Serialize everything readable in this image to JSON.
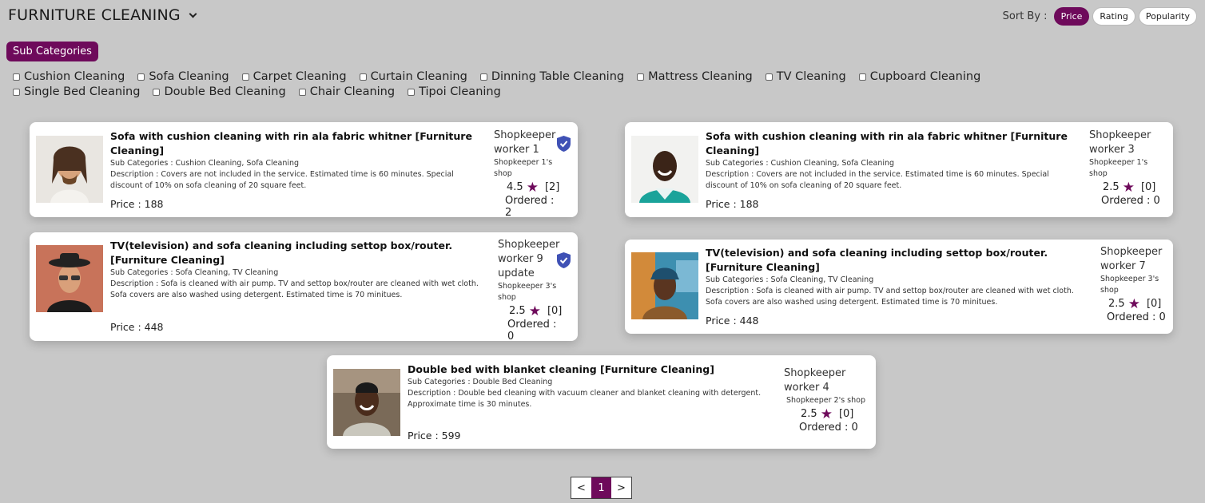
{
  "header": {
    "title": "FURNITURE CLEANING"
  },
  "sort": {
    "label": "Sort By :",
    "options": [
      "Price",
      "Rating",
      "Popularity"
    ],
    "active": "Price"
  },
  "subcategories": {
    "button_label": "Sub Categories",
    "items": [
      "Cushion Cleaning",
      "Sofa Cleaning",
      "Carpet Cleaning",
      "Curtain Cleaning",
      "Dinning Table Cleaning",
      "Mattress Cleaning",
      "TV Cleaning",
      "Cupboard Cleaning",
      "Single Bed Cleaning",
      "Double Bed Cleaning",
      "Chair Cleaning",
      "Tipoi Cleaning"
    ]
  },
  "cards": [
    {
      "title": "Sofa with cushion cleaning with rin ala fabric whitner [Furniture Cleaning]",
      "sub": "Sub Categories : Cushion Cleaning, Sofa Cleaning",
      "desc": "Description : Covers are not included in the service. Estimated time is 60 minutes. Special discount of 10% on sofa cleaning of 20 square feet.",
      "price": "Price : 188",
      "worker": "Shopkeeper worker 1",
      "shop": "Shopkeeper 1's shop",
      "rating": "4.5",
      "reviews": "[2]",
      "ordered": "Ordered : 2",
      "verified": true
    },
    {
      "title": "Sofa with cushion cleaning with rin ala fabric whitner [Furniture Cleaning]",
      "sub": "Sub Categories : Cushion Cleaning, Sofa Cleaning",
      "desc": "Description : Covers are not included in the service. Estimated time is 60 minutes. Special discount of 10% on sofa cleaning of 20 square feet.",
      "price": "Price : 188",
      "worker": "Shopkeeper worker 3",
      "shop": "Shopkeeper 1's shop",
      "rating": "2.5",
      "reviews": "[0]",
      "ordered": "Ordered : 0",
      "verified": false
    },
    {
      "title": "TV(television) and sofa cleaning including settop box/router. [Furniture Cleaning]",
      "sub": "Sub Categories : Sofa Cleaning, TV Cleaning",
      "desc": "Description : Sofa is cleaned with air pump. TV and settop box/router are cleaned with wet cloth. Sofa covers are also washed using detergent. Estimated time is 70 minitues.",
      "price": "Price : 448",
      "worker": "Shopkeeper worker 9 update",
      "shop": "Shopkeeper 3's shop",
      "rating": "2.5",
      "reviews": "[0]",
      "ordered": "Ordered : 0",
      "verified": true
    },
    {
      "title": "TV(television) and sofa cleaning including settop box/router. [Furniture Cleaning]",
      "sub": "Sub Categories : Sofa Cleaning, TV Cleaning",
      "desc": "Description : Sofa is cleaned with air pump. TV and settop box/router are cleaned with wet cloth. Sofa covers are also washed using detergent. Estimated time is 70 minitues.",
      "price": "Price : 448",
      "worker": "Shopkeeper worker 7",
      "shop": "Shopkeeper 3's shop",
      "rating": "2.5",
      "reviews": "[0]",
      "ordered": "Ordered : 0",
      "verified": false
    },
    {
      "title": "Double bed with blanket cleaning [Furniture Cleaning]",
      "sub": "Sub Categories : Double Bed Cleaning",
      "desc": "Description : Double bed cleaning with vacuum cleaner and blanket cleaning with detergent. Approximate time is 30 minutes.",
      "price": "Price : 599",
      "worker": "Shopkeeper worker 4",
      "shop": "Shopkeeper 2's shop",
      "rating": "2.5",
      "reviews": "[0]",
      "ordered": "Ordered : 0",
      "verified": false
    }
  ],
  "pagination": {
    "prev": "<",
    "current": "1",
    "next": ">"
  },
  "colors": {
    "accent": "#6e0a5b",
    "background": "#c8c8c8",
    "verified": "#3f51b5"
  }
}
